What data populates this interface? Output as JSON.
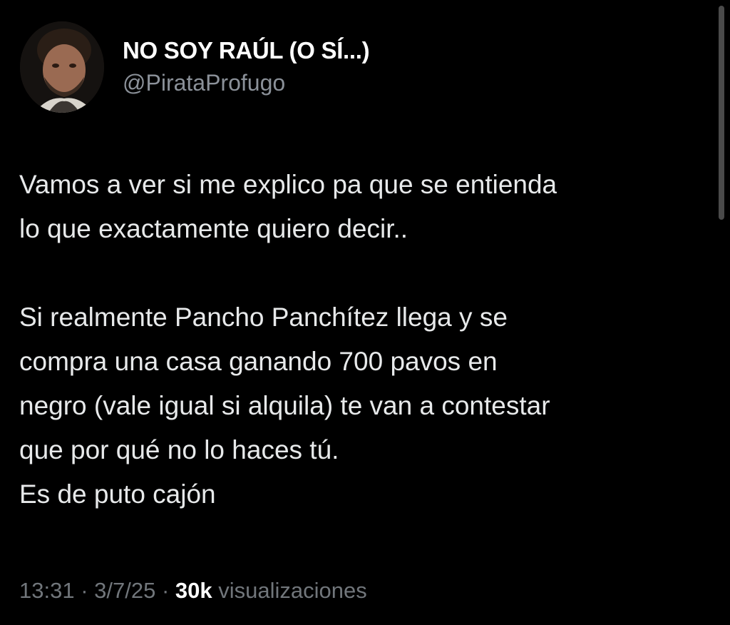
{
  "tweet": {
    "display_name": "NO SOY RAÚL (O SÍ...)",
    "handle": "@PirataProfugo",
    "paragraph1": "Vamos a ver si me explico pa que se entienda\nlo que exactamente quiero decir..",
    "paragraph2": "Si realmente Pancho Panchítez llega y se\ncompra una casa ganando 700 pavos en\nnegro (vale igual si alquila) te van a contestar\nque por qué no lo haces tú.\nEs de puto cajón",
    "time": "13:31",
    "date": "3/7/25",
    "separator": " · ",
    "views_count": "30k",
    "views_label": "visualizaciones"
  },
  "colors": {
    "background": "#000000",
    "primary_text": "#e7e9ea",
    "secondary_text": "#71767b"
  },
  "icons": {
    "avatar": "profile-photo"
  }
}
